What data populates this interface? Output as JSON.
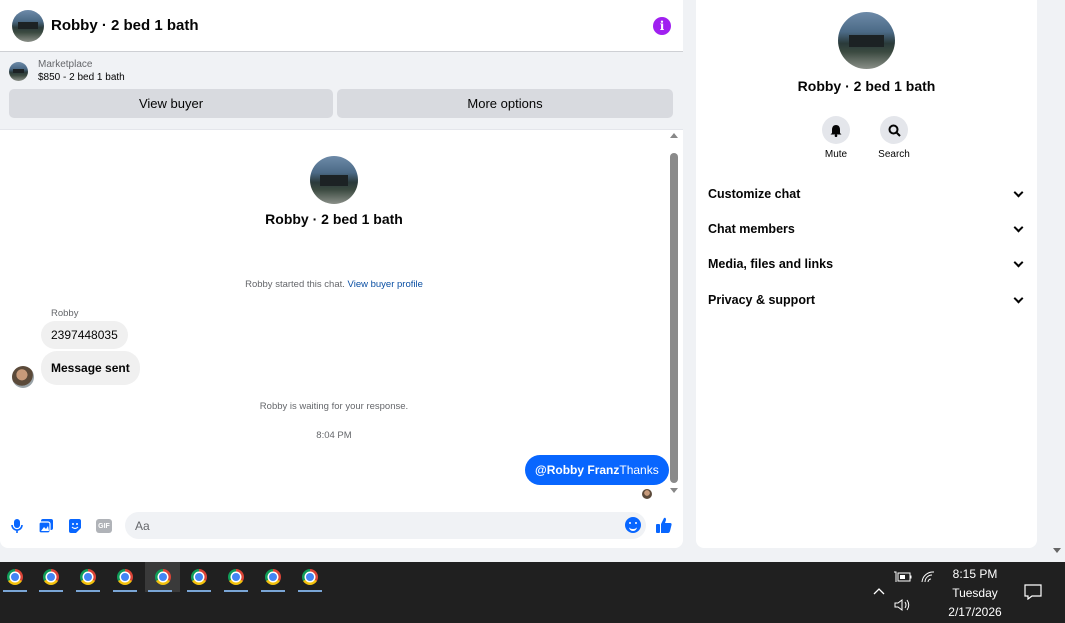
{
  "chat": {
    "title": "Robby · 2 bed 1 bath",
    "info_glyph": "i",
    "listing": {
      "source": "Marketplace",
      "price_line": "$850 - 2 bed 1 bath"
    },
    "buttons": {
      "view_buyer": "View buyer",
      "more_options": "More options"
    },
    "thread": {
      "name": "Robby · 2 bed 1 bath",
      "started_text": "Robby started this chat. ",
      "started_link": "View buyer profile",
      "sender_name": "Robby",
      "messages_in": [
        "2397448035",
        "Message sent"
      ],
      "waiting_text": "Robby is waiting for your response.",
      "timestamp": "8:04 PM",
      "message_out_mention": "@Robby Franz",
      "message_out_text": "Thanks"
    },
    "composer": {
      "placeholder": "Aa",
      "gif_label": "GIF"
    }
  },
  "info_panel": {
    "name": "Robby · 2 bed 1 bath",
    "actions": [
      {
        "label": "Mute",
        "icon": "bell-icon"
      },
      {
        "label": "Search",
        "icon": "search-icon"
      }
    ],
    "menu": [
      "Customize chat",
      "Chat members",
      "Media, files and links",
      "Privacy & support"
    ]
  },
  "taskbar": {
    "time": "8:15 PM",
    "day": "Tuesday",
    "date": "2/17/2026",
    "apps": [
      "chrome",
      "chrome",
      "chrome",
      "chrome",
      "chrome",
      "chrome",
      "chrome",
      "chrome",
      "chrome"
    ]
  },
  "colors": {
    "accent": "#0866ff",
    "info_icon": "#a020f0",
    "link": "#0a4fa3"
  }
}
